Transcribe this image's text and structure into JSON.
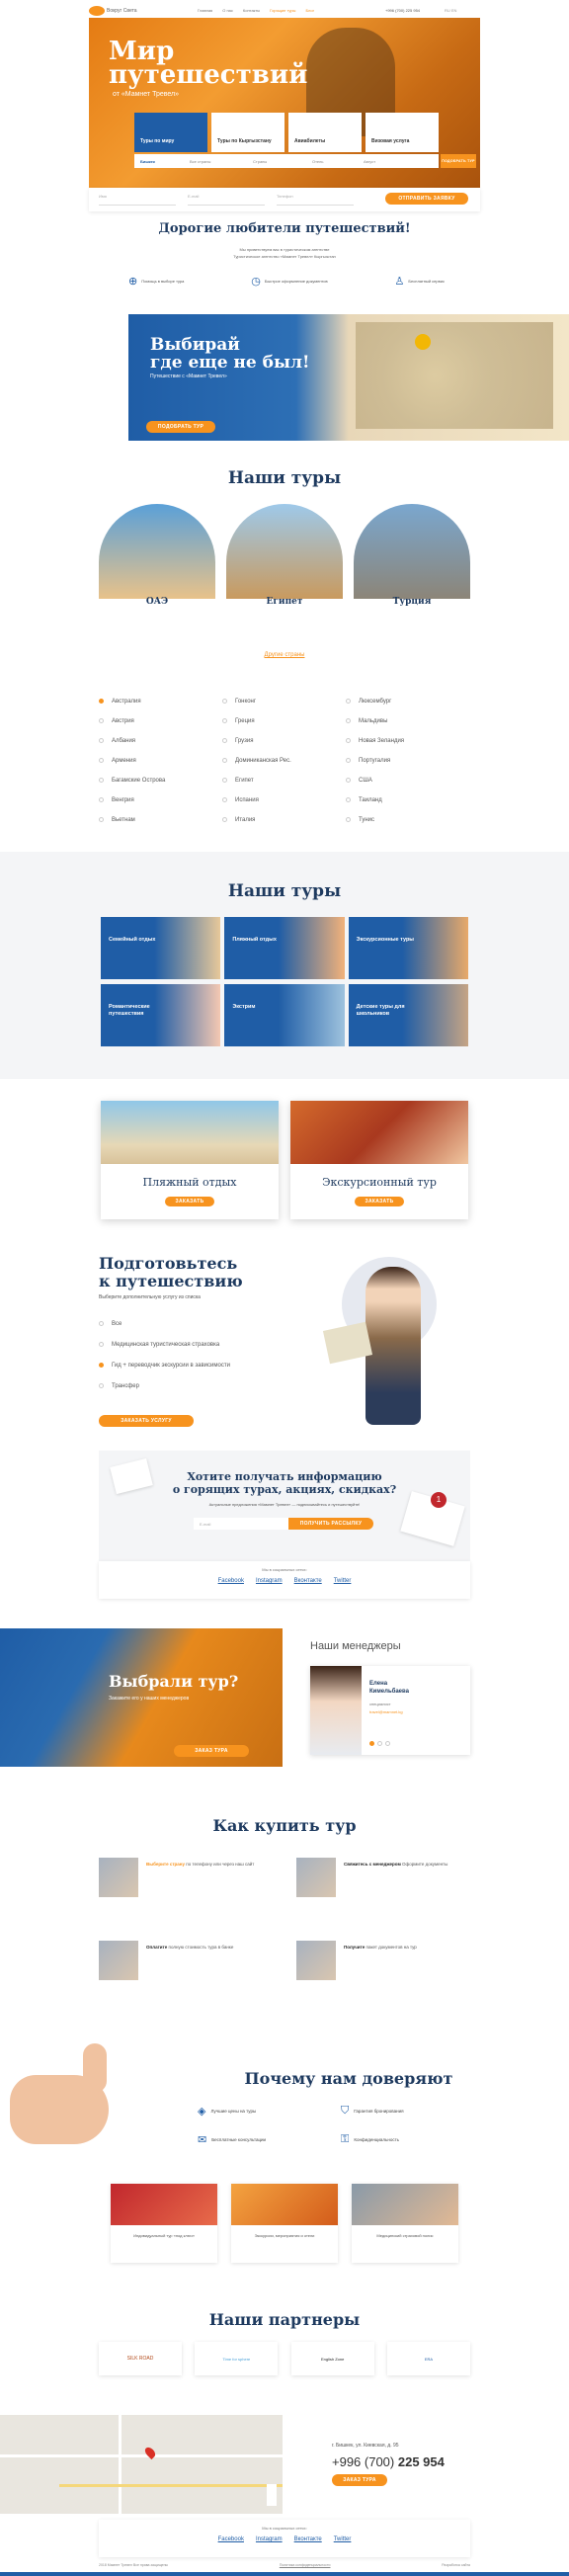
{
  "header": {
    "logo": "Вокруг Света",
    "nav": [
      "Главная",
      "О нас",
      "Контакты",
      "Горящие туры",
      "Блог"
    ],
    "phone": "+996 (700) 225 954",
    "lang": "RU  EN"
  },
  "hero": {
    "title_line1": "Мир",
    "title_line2": "путешествий",
    "subtitle": "от «Мамнет Тревел»",
    "tabs": [
      "Туры по миру",
      "Туры по Кыргызстану",
      "Авиабилеты",
      "Визовая услуга"
    ],
    "search": {
      "fields": [
        "Бишкек",
        "Все страны",
        "Страны",
        "Отель",
        "Август"
      ],
      "row2": [
        "Имя",
        "E-mail",
        "Телефон"
      ],
      "button": "ПОДОБРАТЬ ТУР"
    },
    "submit": "ОТПРАВИТЬ ЗАЯВКУ"
  },
  "welcome": {
    "title": "Дорогие любители путешествий!",
    "text1": "Мы приветствуем вас в туристическом агентстве",
    "text2": "Туристическое агентство «Мамнет Тревел» Кыргызстан",
    "features": [
      "Помощь в выборе тура",
      "Быстрое оформление документов",
      "Бесплатный сервис"
    ]
  },
  "promo": {
    "title1": "Выбирай",
    "title2": "где еще не был!",
    "sub": "Путешествие с «Мамнет Тревел»",
    "btn": "ПОДОБРАТЬ ТУР"
  },
  "tours1": {
    "title": "Наши туры",
    "items": [
      "ОАЭ",
      "Египет",
      "Турция"
    ],
    "link": "Другие страны"
  },
  "countries": [
    [
      "Австралия",
      "Австрия",
      "Албания",
      "Армения",
      "Багамские Острова",
      "Венгрия",
      "Вьетнам"
    ],
    [
      "Гонконг",
      "Греция",
      "Грузия",
      "Доминиканская Рес.",
      "Египет",
      "Испания",
      "Италия"
    ],
    [
      "Люксембург",
      "Мальдивы",
      "Новая Зеландия",
      "Португалия",
      "США",
      "Таиланд",
      "Тунис"
    ]
  ],
  "tours2": {
    "title": "Наши туры",
    "items": [
      "Семейный отдых",
      "Пляжный отдых",
      "Экскурсионные туры",
      "Романтические путешествия",
      "Экстрим",
      "Детские туры для школьников"
    ]
  },
  "cards": [
    {
      "title": "Пляжный отдых",
      "btn": "ЗАКАЗАТЬ"
    },
    {
      "title": "Экскурсионный тур",
      "btn": "ЗАКАЗАТЬ"
    }
  ],
  "prepare": {
    "title1": "Подготовьтесь",
    "title2": "к путешествию",
    "sub": "Выберите дополнительную услугу из списка",
    "options": [
      "Все",
      "Медицинская туристическая страховка",
      "Гид + переводчик экскурсии в зависимости",
      "Трансфер"
    ],
    "btn": "ЗАКАЗАТЬ УСЛУГУ"
  },
  "subscribe": {
    "title1": "Хотите получать информацию",
    "title2": "о горящих турах, акциях, скидках?",
    "text": "Актуальные предложения «Мамнет Тревел» — подписывайтесь и путешествуйте!",
    "placeholder": "E-mail",
    "btn": "ПОЛУЧИТЬ РАССЫЛКУ",
    "social_title": "Мы в социальных сетях:",
    "social": [
      "Facebook",
      "Instagram",
      "Вконтакте",
      "Twitter"
    ]
  },
  "chose": {
    "title": "Выбрали тур?",
    "sub": "Закажите его у наших менеджеров",
    "btn": "ЗАКАЗ ТУРА"
  },
  "managers": {
    "title": "Наши менеджеры",
    "name1": "Елена",
    "name2": "Кимельбаева",
    "role": "специалист",
    "email": "travel@mamnet.kg"
  },
  "howbuy": {
    "title": "Как купить тур",
    "steps": [
      {
        "bold": "Выберите страну",
        "text": "по телефону или через наш сайт"
      },
      {
        "bold": "Свяжитесь с менеджером",
        "text": "Оформите документы"
      },
      {
        "bold": "Оплатите",
        "text": "полную стоимость тура в банке"
      },
      {
        "bold": "Получите",
        "text": "пакет документов на тур"
      }
    ]
  },
  "trust": {
    "title": "Почему нам доверяют",
    "items": [
      "Лучшие цены на туры",
      "Гарантия бронирования",
      "Бесплатные консультации",
      "Конфиденциальность"
    ],
    "photos": [
      "Индивидуальный тур «под ключ»",
      "Экскурсии, мероприятия и отели",
      "Медицинский страховой полис"
    ]
  },
  "partners": {
    "title": "Наши партнеры",
    "items": [
      "SILK ROAD",
      "Time for sphere",
      "English Zone",
      "ERA"
    ]
  },
  "contacts": {
    "address": "г. Бишкек, ул. Киевская, д. 95",
    "phone_pre": "+996 (700)",
    "phone": "225 954",
    "btn": "ЗАКАЗ ТУРА",
    "social_title": "Мы в социальных сетях:",
    "social": [
      "Facebook",
      "Instagram",
      "Вконтакте",
      "Twitter"
    ],
    "copyright": "2018 Мамнет Тревел Все права защищены",
    "policy": "Политика конфиденциальности",
    "dev": "Разработка сайта"
  },
  "colors": {
    "orange": "#f7931e",
    "blue": "#1f5da6",
    "navy": "#1e3a5f"
  }
}
